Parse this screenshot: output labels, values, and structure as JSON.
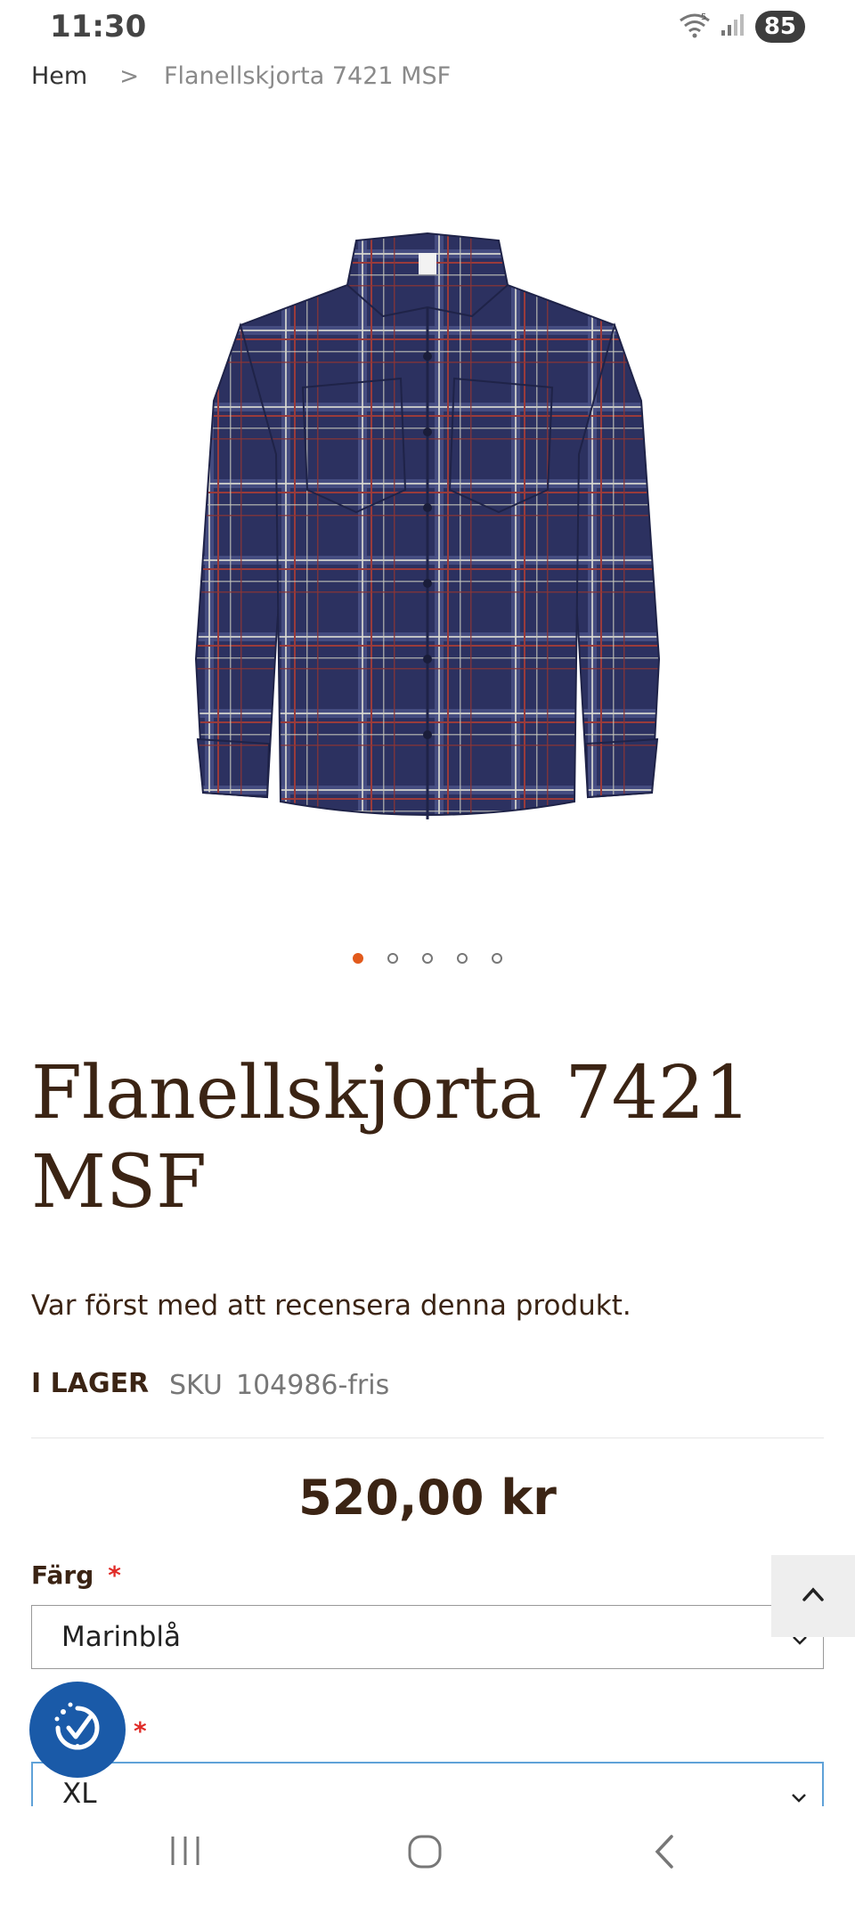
{
  "status_bar": {
    "time": "11:30",
    "battery": "85",
    "wifi_badge": "5"
  },
  "breadcrumb": {
    "home": "Hem",
    "separator": ">",
    "current": "Flanellskjorta 7421 MSF"
  },
  "gallery": {
    "dot_count": 5,
    "active_dot": 1
  },
  "product": {
    "title": "Flanellskjorta 7421 MSF",
    "review_prompt": "Var först med att recensera denna produkt.",
    "stock": "I LAGER",
    "sku_label": "SKU",
    "sku_value": "104986-fris",
    "price": "520,00 kr"
  },
  "options": {
    "color": {
      "label": "Färg",
      "required_mark": "*",
      "value": "Marinblå"
    },
    "size": {
      "required_mark": "*",
      "value": "XL"
    }
  },
  "colors": {
    "accent": "#e25a1c",
    "text": "#3b2414",
    "badge": "#1a5aa8",
    "focus": "#5fa2d8",
    "required": "#e02b27"
  },
  "icons": {
    "back_to_top": "chevron-up-icon",
    "badge": "certification-badge-icon",
    "nav_recent": "recent-apps-icon",
    "nav_home": "home-icon",
    "nav_back": "back-icon"
  }
}
